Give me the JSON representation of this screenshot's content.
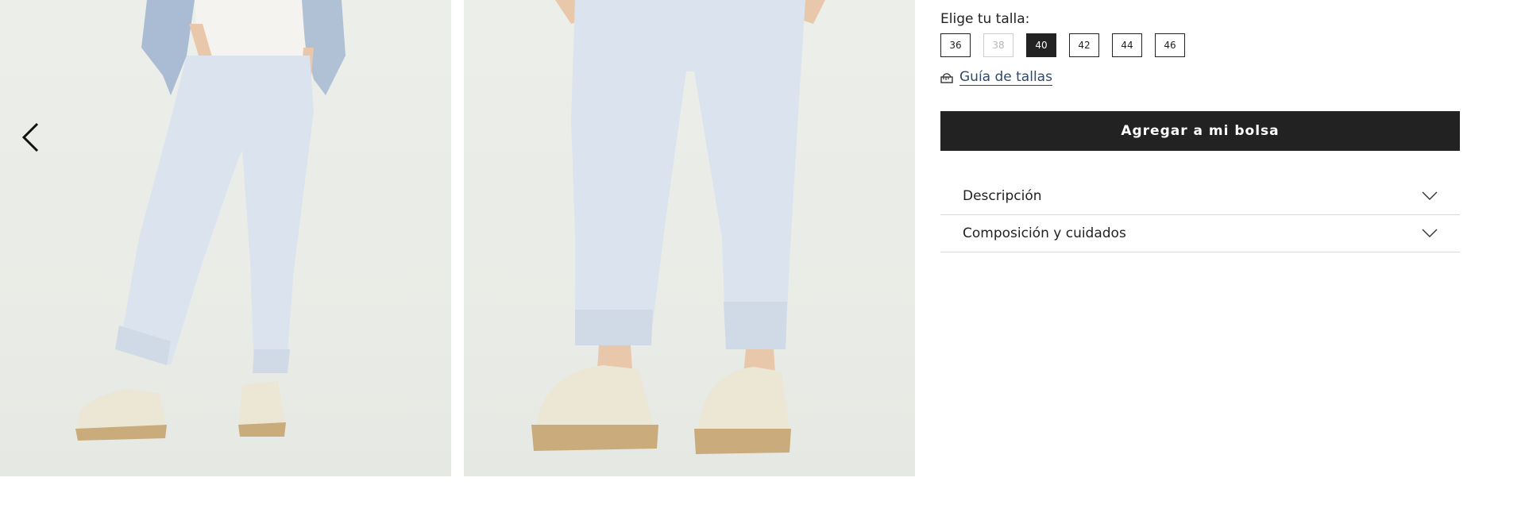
{
  "gallery": {
    "images": [
      {
        "alt": ""
      },
      {
        "alt": ""
      }
    ],
    "prev_icon": "chevron-left-icon"
  },
  "product": {
    "size_prompt": "Elige tu talla:",
    "sizes": [
      {
        "label": "36",
        "state": "available"
      },
      {
        "label": "38",
        "state": "disabled"
      },
      {
        "label": "40",
        "state": "selected"
      },
      {
        "label": "42",
        "state": "available"
      },
      {
        "label": "44",
        "state": "available"
      },
      {
        "label": "46",
        "state": "available"
      }
    ],
    "size_guide_label": "Guía de tallas",
    "size_guide_icon": "ruler-icon",
    "add_to_bag_label": "Agregar a mi bolsa"
  },
  "accordion": [
    {
      "label": "Descripción",
      "icon": "chevron-down-icon"
    },
    {
      "label": "Composición y cuidados",
      "icon": "chevron-down-icon"
    }
  ],
  "colors": {
    "accent_dark": "#222222",
    "link": "#2d4a6b",
    "disabled": "#b5b5b5"
  }
}
